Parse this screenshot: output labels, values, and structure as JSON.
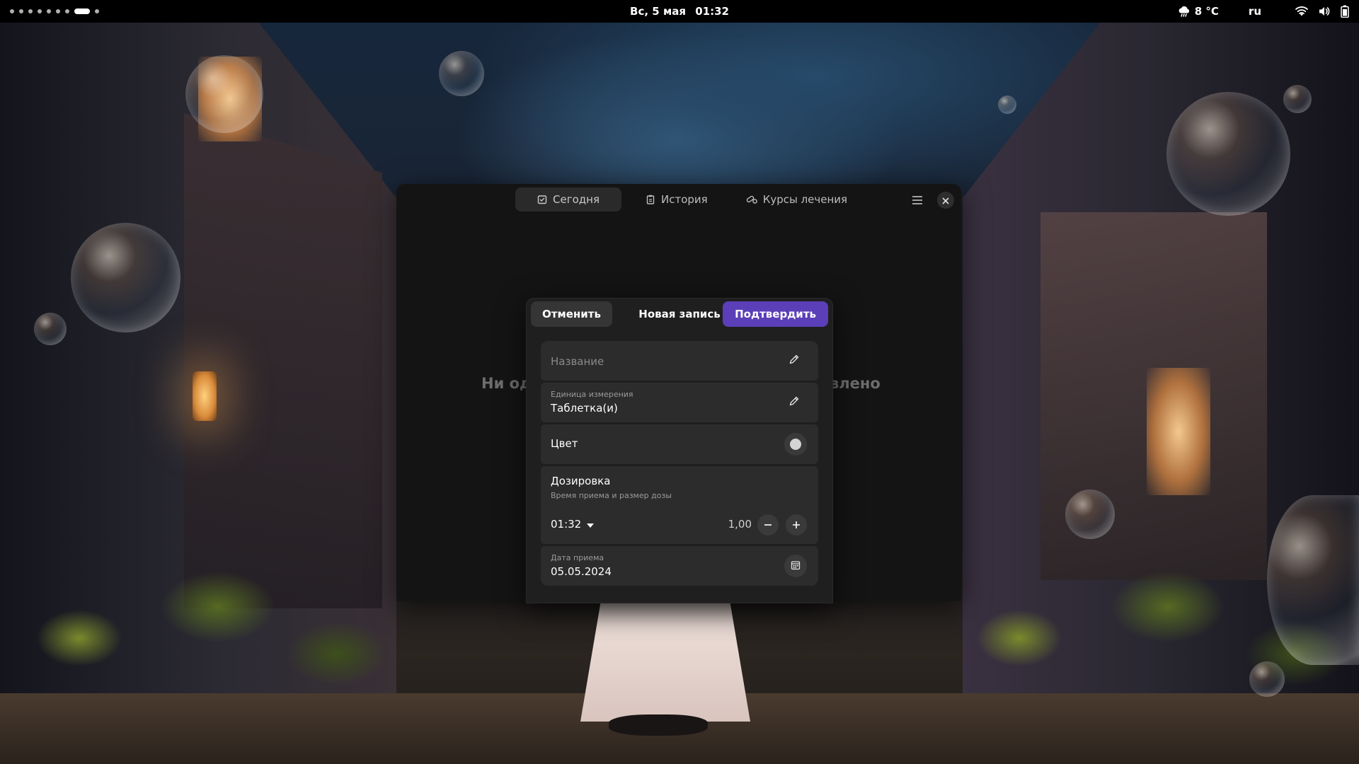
{
  "topbar": {
    "date": "Вс, 5 мая",
    "time": "01:32",
    "weather_temp": "8 °C",
    "keyboard_layout": "ru"
  },
  "app": {
    "tabs": [
      {
        "label": "Сегодня",
        "icon": "calendar-check-icon",
        "active": true
      },
      {
        "label": "История",
        "icon": "clipboard-icon",
        "active": false
      },
      {
        "label": "Курсы лечения",
        "icon": "pill-icon",
        "active": false
      }
    ],
    "empty_state_left": "Ни од",
    "empty_state_right": "влено"
  },
  "dialog": {
    "cancel_label": "Отменить",
    "title": "Новая запись",
    "confirm_label": "Подтвердить",
    "name_placeholder": "Название",
    "unit_label": "Единица измерения",
    "unit_value": "Таблетка(и)",
    "color_label": "Цвет",
    "dosage_title": "Дозировка",
    "dosage_subtitle": "Время приема и размер дозы",
    "dose_time": "01:32",
    "dose_amount": "1,00",
    "date_label": "Дата приема",
    "date_value": "05.05.2024"
  },
  "colors": {
    "accent": "#5b3fb8",
    "window_bg": "#141414",
    "dialog_bg": "#1f1f1f",
    "row_bg": "#2c2c2c",
    "swatch": "#d4d4d4"
  }
}
